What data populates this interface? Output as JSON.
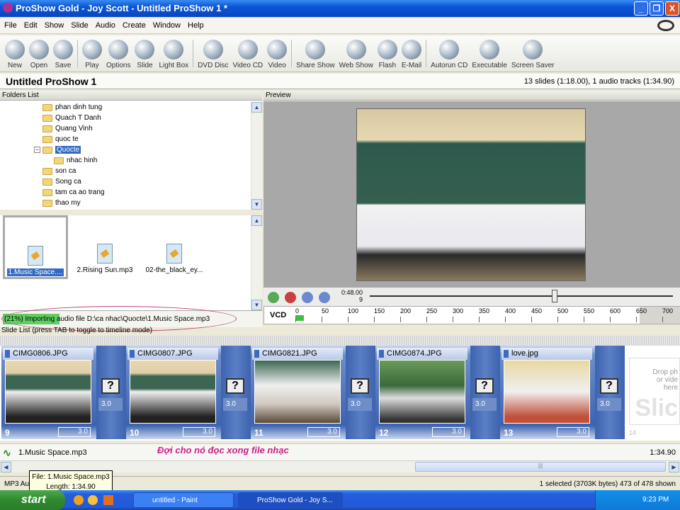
{
  "window": {
    "title": "ProShow Gold - Joy Scott - Untitled ProShow 1 *",
    "minimize": "_",
    "restore": "❐",
    "close": "X"
  },
  "menu": [
    "File",
    "Edit",
    "Show",
    "Slide",
    "Audio",
    "Create",
    "Window",
    "Help"
  ],
  "toolbar": [
    [
      "New",
      "Open",
      "Save"
    ],
    [
      "Play",
      "Options",
      "Slide",
      "Light Box"
    ],
    [
      "DVD Disc",
      "Video CD",
      "Video"
    ],
    [
      "Share Show",
      "Web Show",
      "Flash",
      "E-Mail"
    ],
    [
      "Autorun CD",
      "Executable",
      "Screen Saver"
    ]
  ],
  "project": {
    "title": "Untitled ProShow 1",
    "info": "13 slides (1:18.00), 1 audio tracks (1:34.90)"
  },
  "folders": {
    "header": "Folders List",
    "items": [
      {
        "label": "phan dinh tung",
        "level": 0
      },
      {
        "label": "Quach T Danh",
        "level": 0
      },
      {
        "label": "Quang Vinh",
        "level": 0
      },
      {
        "label": "quoc te",
        "level": 0
      },
      {
        "label": "Quocte",
        "level": 0,
        "selected": true,
        "expanded": true
      },
      {
        "label": "nhac hinh",
        "level": 1
      },
      {
        "label": "son ca",
        "level": 0
      },
      {
        "label": "Song ca",
        "level": 0
      },
      {
        "label": "tam ca ao trang",
        "level": 0
      },
      {
        "label": "thao my",
        "level": 0
      }
    ]
  },
  "files": [
    {
      "label": "1.Music Space....",
      "selected": true
    },
    {
      "label": "2.Rising Sun.mp3"
    },
    {
      "label": "02-the_black_ey..."
    }
  ],
  "import": {
    "text": "(21%) Importing audio file D:\\ca nhac\\Quocte\\1.Music Space.mp3",
    "progress": 21
  },
  "slide_list_label": "Slide List (press TAB to toggle to timeline mode)",
  "preview": {
    "header": "Preview",
    "time": "0:48.00",
    "slide": "9",
    "position_fraction": 0.61
  },
  "ruler": {
    "label": "VCD",
    "ticks": [
      "0",
      "50",
      "100",
      "150",
      "200",
      "250",
      "300",
      "350",
      "400",
      "450",
      "500",
      "550",
      "600",
      "650",
      "700"
    ]
  },
  "slides": [
    {
      "name": "CIMG0806.JPG",
      "num": "9",
      "dur": "3.0",
      "trans": "3.0"
    },
    {
      "name": "CIMG0807.JPG",
      "num": "10",
      "dur": "3.0",
      "trans": "3.0"
    },
    {
      "name": "CIMG0821.JPG",
      "num": "11",
      "dur": "3.0",
      "trans": "3.0"
    },
    {
      "name": "CIMG0874.JPG",
      "num": "12",
      "dur": "3.0",
      "trans": "3.0"
    },
    {
      "name": "love.jpg",
      "num": "13",
      "dur": "3.0",
      "trans": "3.0"
    }
  ],
  "drop": {
    "line1": "Drop ph",
    "line2": "or vide",
    "line3": "here",
    "big": "Slic",
    "num": "14"
  },
  "audio": {
    "name": "1.Music Space.mp3",
    "note": "Đợi cho nó đọc xong file nhạc",
    "length": "1:34.90"
  },
  "status": {
    "left": "MP3 Au                         .Music Space.mp3",
    "right": "1 selected (3703K bytes) 473 of 478 shown"
  },
  "tooltip": {
    "line1": "File: 1.Music Space.mp3",
    "line2": "Length: 1:34.90"
  },
  "taskbar": {
    "start": "start",
    "tasks": [
      "untitled - Paint",
      "ProShow Gold - Joy S..."
    ],
    "clock": "9:23 PM"
  }
}
